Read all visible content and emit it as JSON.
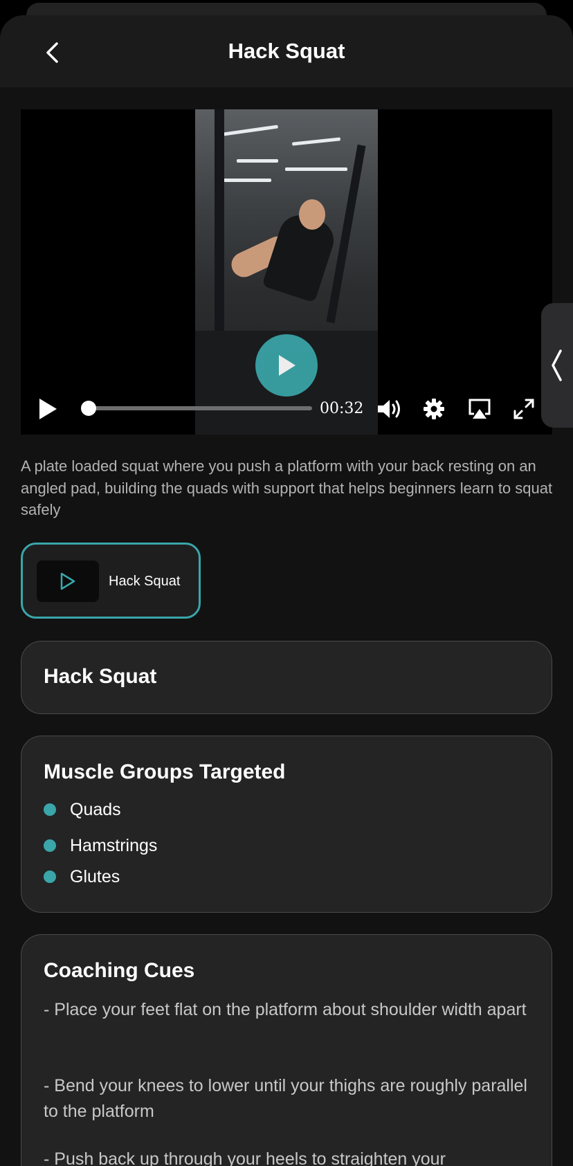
{
  "header": {
    "title": "Hack Squat"
  },
  "video": {
    "time": "00:32",
    "progress": 0.0
  },
  "description": "A plate loaded squat where you push a platform with your back resting on an angled pad, building the quads with support that helps beginners learn to squat safely",
  "video_chip": {
    "label": "Hack Squat"
  },
  "name_card": {
    "title": "Hack Squat"
  },
  "muscles": {
    "title": "Muscle Groups Targeted",
    "items": [
      "Quads",
      "Hamstrings",
      "Glutes"
    ]
  },
  "cues": {
    "title": "Coaching Cues",
    "items": [
      "- Place your feet flat on the platform about shoulder width apart",
      "- Bend your knees to lower until your thighs are roughly parallel to the platform",
      "- Push back up through your heels to straighten your"
    ]
  },
  "colors": {
    "accent": "#3aa6aa",
    "background": "#121212",
    "card": "#242425"
  },
  "icons": {
    "back": "chevron-left-icon",
    "play": "play-icon",
    "volume": "volume-icon",
    "settings": "gear-icon",
    "airplay": "airplay-icon",
    "fullscreen": "fullscreen-icon",
    "side_tab": "chevron-left-icon"
  }
}
